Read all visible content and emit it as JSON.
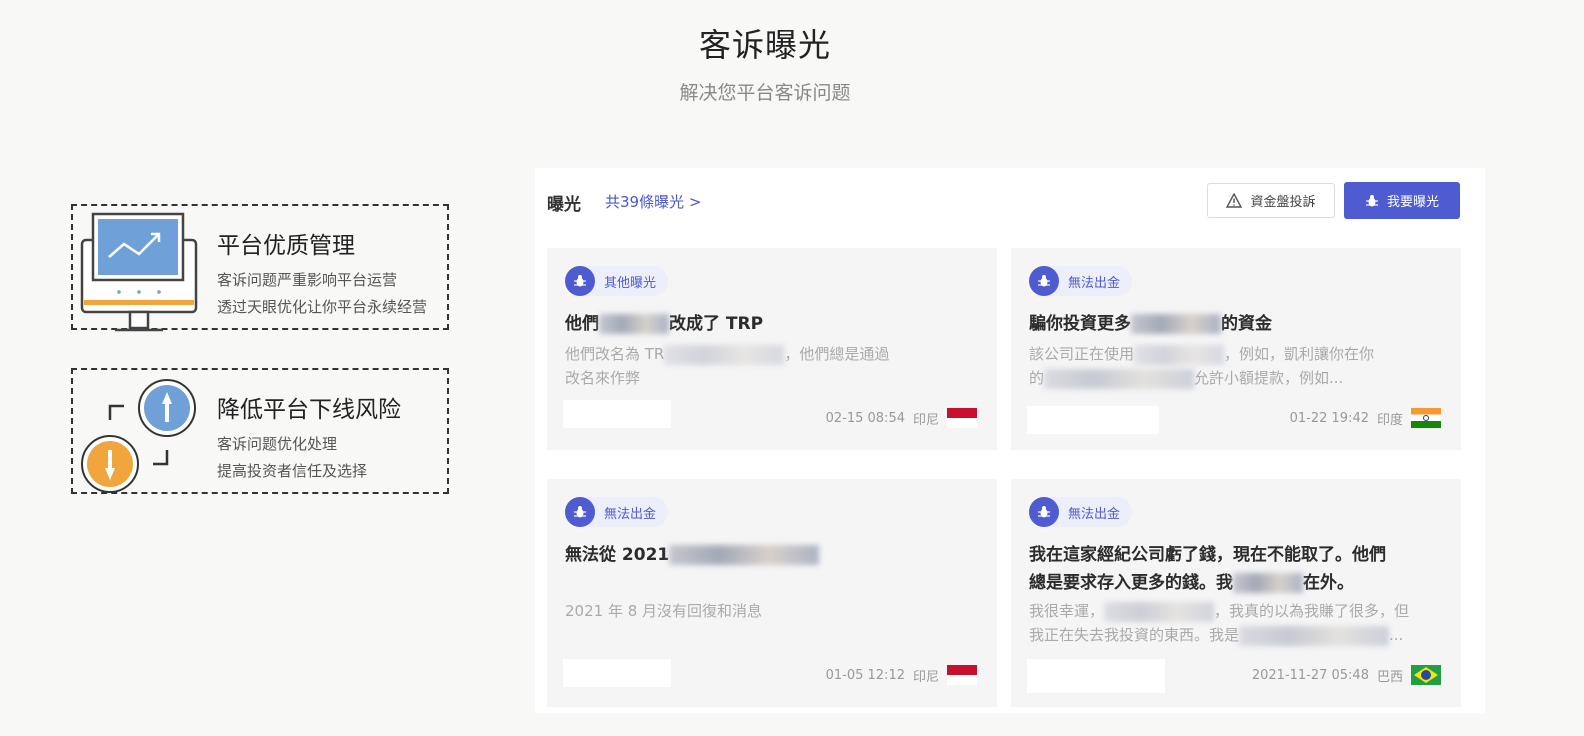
{
  "header": {
    "title": "客诉曝光",
    "subtitle": "解决您平台客诉问题"
  },
  "features": [
    {
      "title": "平台优质管理",
      "lines": [
        "客诉问题严重影响平台运营",
        "透过天眼优化让你平台永续经营"
      ],
      "icon": "monitor-chart-icon"
    },
    {
      "title": "降低平台下线风险",
      "lines": [
        "客诉问题优化处理",
        "提高投资者信任及选择"
      ],
      "icon": "up-down-arrows-icon"
    }
  ],
  "panel": {
    "label": "曝光",
    "count_link": "共39條曝光 >",
    "complain_button": "資金盤投訴",
    "expose_button": "我要曝光"
  },
  "cards": [
    {
      "tag": "其他曝光",
      "title_visible": [
        "他們",
        "改成了 TRP"
      ],
      "desc_visible": [
        "他們改名為 TR",
        "，他們總是通過",
        "改名來作弊"
      ],
      "time": "02-15 08:54",
      "country": "印尼",
      "flag": "indonesia"
    },
    {
      "tag": "無法出金",
      "title_visible": [
        "騙你投資更多",
        "的資金"
      ],
      "desc_visible": [
        "該公司正在使用",
        "，例如，凱利讓你在你",
        "的",
        "允許小額提款，例如..."
      ],
      "time": "01-22 19:42",
      "country": "印度",
      "flag": "india"
    },
    {
      "tag": "無法出金",
      "title_visible": [
        "無法從 2021",
        ""
      ],
      "desc_visible": [
        "2021 年 8 月沒有回復和消息"
      ],
      "time": "01-05 12:12",
      "country": "印尼",
      "flag": "indonesia"
    },
    {
      "tag": "無法出金",
      "title_visible": [
        "我在這家經紀公司虧了錢，現在不能取了。他們",
        "總是要求存入更多的錢。我",
        "在外。"
      ],
      "desc_visible": [
        "我很幸運，",
        "，我真的以為我賺了很多，但",
        "我正在失去我投資的東西。我是",
        "..."
      ],
      "time": "2021-11-27 05:48",
      "country": "巴西",
      "flag": "brazil"
    }
  ],
  "colors": {
    "accent": "#4f5bd0",
    "monitor_blue": "#6fa0d8",
    "orange": "#f0a63c"
  }
}
